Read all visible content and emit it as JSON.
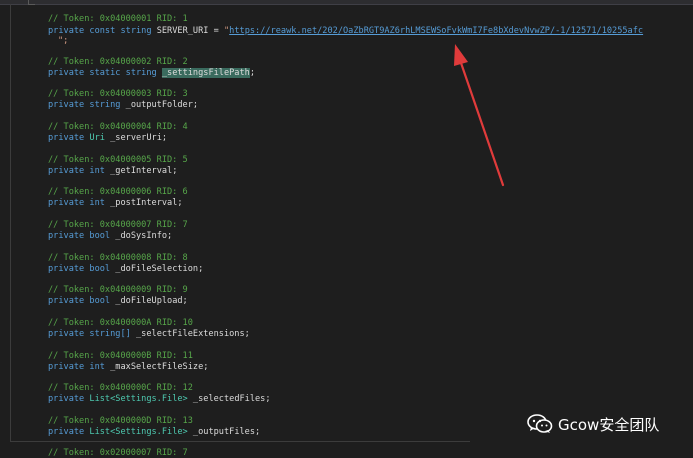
{
  "code": {
    "block_1": {
      "comment": "// Token: 0x04000001 RID: 1",
      "kw1": "private",
      "kw2": "const",
      "kw3": "string",
      "name": "SERVER_URI",
      "eq": " = ",
      "quote_open": "\"",
      "url": "https://reawk.net/202/OaZbRGT9AZ6rhLMSEWSoFvkWmI7Fe8bXdevNvwZP/-1/12571/10255afc",
      "cont": "\";"
    },
    "block_2": {
      "comment": "// Token: 0x04000002 RID: 2",
      "kw1": "private",
      "kw2": "static",
      "type": "string",
      "name": "_settingsFilePath",
      "end": ";"
    },
    "block_3": {
      "comment": "// Token: 0x04000003 RID: 3",
      "kw1": "private",
      "type": "string",
      "name": "_outputFolder;"
    },
    "block_4": {
      "comment": "// Token: 0x04000004 RID: 4",
      "kw1": "private",
      "type": "Uri",
      "name": "_serverUri;"
    },
    "block_5": {
      "comment": "// Token: 0x04000005 RID: 5",
      "kw1": "private",
      "type": "int",
      "name": "_getInterval;"
    },
    "block_6": {
      "comment": "// Token: 0x04000006 RID: 6",
      "kw1": "private",
      "type": "int",
      "name": "_postInterval;"
    },
    "block_7": {
      "comment": "// Token: 0x04000007 RID: 7",
      "kw1": "private",
      "type": "bool",
      "name": "_doSysInfo;"
    },
    "block_8": {
      "comment": "// Token: 0x04000008 RID: 8",
      "kw1": "private",
      "type": "bool",
      "name": "_doFileSelection;"
    },
    "block_9": {
      "comment": "// Token: 0x04000009 RID: 9",
      "kw1": "private",
      "type": "bool",
      "name": "_doFileUpload;"
    },
    "block_10": {
      "comment": "// Token: 0x0400000A RID: 10",
      "kw1": "private",
      "type": "string[]",
      "name": "_selectFileExtensions;"
    },
    "block_11": {
      "comment": "// Token: 0x0400000B RID: 11",
      "kw1": "private",
      "type": "int",
      "name": "_maxSelectFileSize;"
    },
    "block_12": {
      "comment": "// Token: 0x0400000C RID: 12",
      "kw1": "private",
      "type_a": "List<",
      "type_b": "Settings.File",
      "type_c": ">",
      "name": "_selectedFiles;"
    },
    "block_13": {
      "comment": "// Token: 0x0400000D RID: 13",
      "kw1": "private",
      "type_a": "List<",
      "type_b": "Settings.File",
      "type_c": ">",
      "name": "_outputFiles;"
    },
    "block_14": {
      "comment": "// Token: 0x02000007 RID: 7"
    }
  },
  "watermark": {
    "text": "Gcow安全团队",
    "icon": "wechat-icon"
  },
  "annotation": {
    "icon": "red-arrow-icon",
    "color": "#e03b3b"
  },
  "colors": {
    "background": "#1e1e1e",
    "comment": "#57a64a",
    "keyword": "#569cd6",
    "type": "#4ec9b0",
    "identifier": "#dcdcdc",
    "highlight": "#3a6b5e"
  }
}
